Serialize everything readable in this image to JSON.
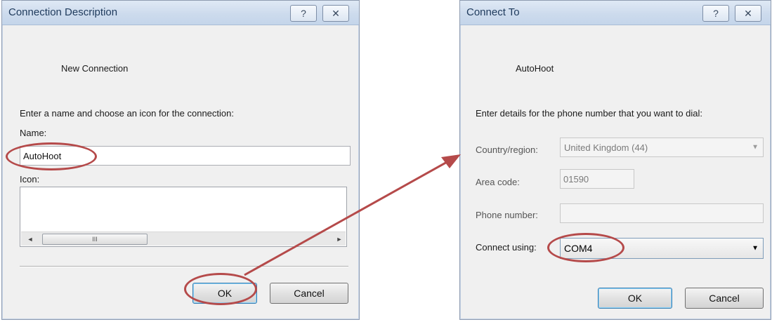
{
  "connection_description": {
    "title": "Connection Description",
    "help_glyph": "?",
    "close_glyph": "✕",
    "heading": "New Connection",
    "instruction": "Enter a name and choose an icon for the connection:",
    "name_label": "Name:",
    "name_value": "AutoHoot",
    "icon_label": "Icon:",
    "scroll_left_glyph": "◄",
    "scroll_right_glyph": "►",
    "scroll_grip": "III",
    "ok_label": "OK",
    "cancel_label": "Cancel"
  },
  "connect_to": {
    "title": "Connect To",
    "help_glyph": "?",
    "close_glyph": "✕",
    "heading": "AutoHoot",
    "instruction": "Enter details for the phone number that you want to dial:",
    "country_label": "Country/region:",
    "country_value": "United Kingdom (44)",
    "area_code_label": "Area code:",
    "area_code_value": "01590",
    "phone_label": "Phone number:",
    "phone_value": "",
    "connect_using_label": "Connect using:",
    "connect_using_value": "COM4",
    "dropdown_glyph": "▼",
    "ok_label": "OK",
    "cancel_label": "Cancel"
  },
  "annotation": {
    "highlight_color": "#b54a4a"
  }
}
